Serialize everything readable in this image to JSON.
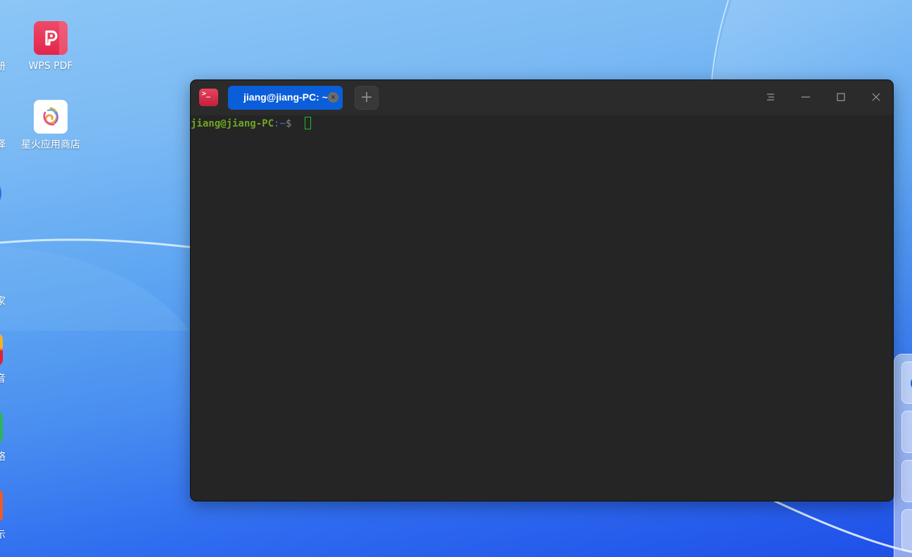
{
  "desktop": {
    "icons": [
      {
        "label": "WPS PDF",
        "icon": "wps-pdf-icon"
      },
      {
        "label": "星火应用商店",
        "icon": "spark-store-icon"
      }
    ],
    "edge_labels": [
      "册",
      "译",
      "家",
      "音",
      "络",
      "示"
    ]
  },
  "terminal": {
    "tab_label": "jiang@jiang-PC: ~",
    "new_tab_symbol": "+",
    "tab_close_symbol": "×",
    "prompt_user": "jiang@jiang-PC",
    "prompt_path": ":~",
    "prompt_symbol": "$",
    "buttons": [
      "menu-icon",
      "minimize-icon",
      "maximize-icon",
      "close-icon"
    ]
  },
  "colors": {
    "tab_active": "#0b5ed9",
    "prompt_user": "#6fa524",
    "cursor": "#1cbf2c",
    "app_icon": "#e8435d"
  }
}
